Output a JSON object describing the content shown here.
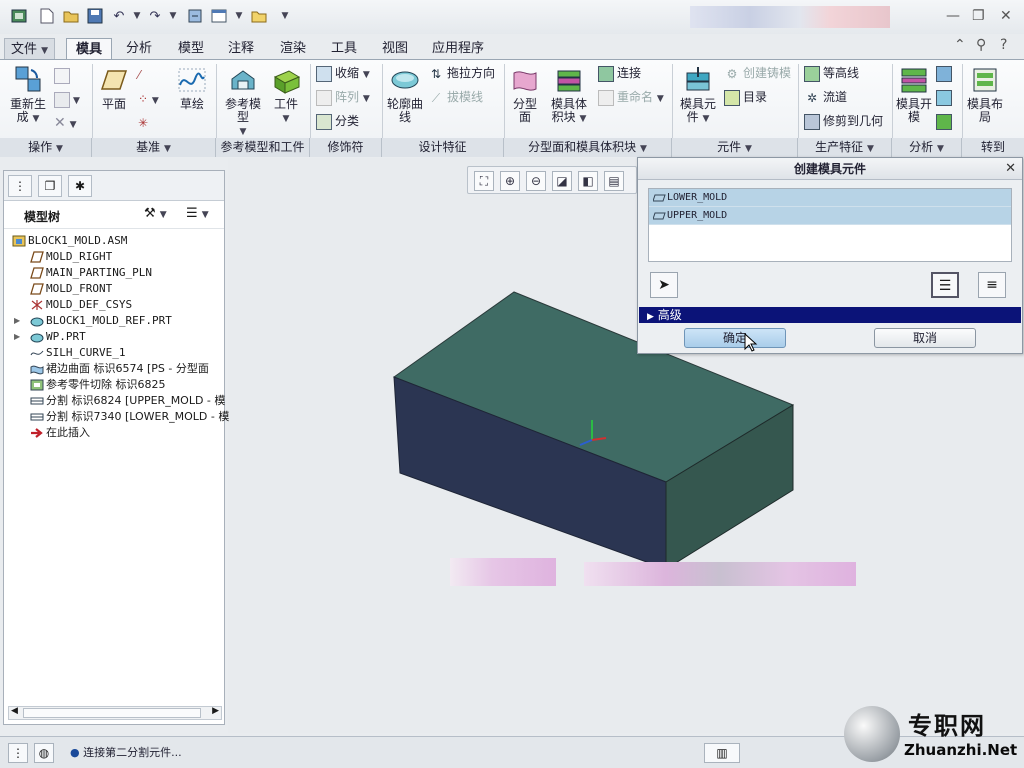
{
  "tabs": {
    "file": "文件",
    "items": [
      "模具",
      "分析",
      "模型",
      "注释",
      "渲染",
      "工具",
      "视图",
      "应用程序"
    ]
  },
  "ribbon": {
    "groups": {
      "operations": "操作",
      "datum": "基准",
      "ref_model_workpiece": "参考模型和工件",
      "modifiers": "修饰符",
      "design_features": "设计特征",
      "parting_volume": "分型面和模具体积块",
      "components": "元件",
      "production_features": "生产特征",
      "analysis": "分析",
      "goto": "转到"
    },
    "buttons": {
      "regenerate": "重新生成",
      "plane": "平面",
      "sketch": "草绘",
      "ref_model": "参考模型",
      "workpiece": "工件",
      "shrink": "收缩",
      "pattern": "阵列",
      "classify": "分类",
      "silhouette_curve": "轮廓曲线",
      "drag_direction": "拖拉方向",
      "draft_line": "拔模线",
      "parting_surface": "分型面",
      "mold_volume": "模具体积块",
      "connect": "连接",
      "rename": "重命名",
      "mold_component": "模具元件",
      "create_casting": "创建铸模",
      "catalog": "目录",
      "isoline": "等高线",
      "runner": "流道",
      "trim_to_geometry": "修剪到几何",
      "mold_open": "模具开模",
      "mold_layout": "模具布局"
    }
  },
  "model_tree": {
    "title": "模型树",
    "items": [
      {
        "label": "BLOCK1_MOLD.ASM",
        "icon": "assembly-icon",
        "expandable": false
      },
      {
        "label": "MOLD_RIGHT",
        "icon": "datum-plane-icon",
        "expandable": false
      },
      {
        "label": "MAIN_PARTING_PLN",
        "icon": "datum-plane-icon",
        "expandable": false
      },
      {
        "label": "MOLD_FRONT",
        "icon": "datum-plane-icon",
        "expandable": false
      },
      {
        "label": "MOLD_DEF_CSYS",
        "icon": "csys-icon",
        "expandable": false
      },
      {
        "label": "BLOCK1_MOLD_REF.PRT",
        "icon": "part-icon",
        "expandable": true
      },
      {
        "label": "WP.PRT",
        "icon": "part-icon",
        "expandable": true
      },
      {
        "label": "SILH_CURVE_1",
        "icon": "curve-icon",
        "expandable": false
      },
      {
        "label": "裙边曲面 标识6574 [PS - 分型面",
        "icon": "surface-icon",
        "expandable": false
      },
      {
        "label": "参考零件切除 标识6825",
        "icon": "cut-icon",
        "expandable": false
      },
      {
        "label": "分割 标识6824 [UPPER_MOLD - 模",
        "icon": "split-icon",
        "expandable": false
      },
      {
        "label": "分割 标识7340 [LOWER_MOLD - 模",
        "icon": "split-icon",
        "expandable": false
      },
      {
        "label": "在此插入",
        "icon": "insert-arrow-icon",
        "expandable": false
      }
    ]
  },
  "dialog": {
    "title": "创建模具元件",
    "list": [
      "LOWER_MOLD",
      "UPPER_MOLD"
    ],
    "advanced": "高级",
    "ok": "确定",
    "cancel": "取消"
  },
  "status": {
    "message": "连接第二分割元件..."
  },
  "watermark": {
    "cn": "专职网",
    "en": "Zhuanzhi.Net"
  },
  "colors": {
    "block_top": "#3f6b64",
    "block_front": "#2b3552",
    "block_side": "#35574f",
    "dialog_advanced": "#0b1378",
    "list_selected": "#b7d3e6"
  }
}
